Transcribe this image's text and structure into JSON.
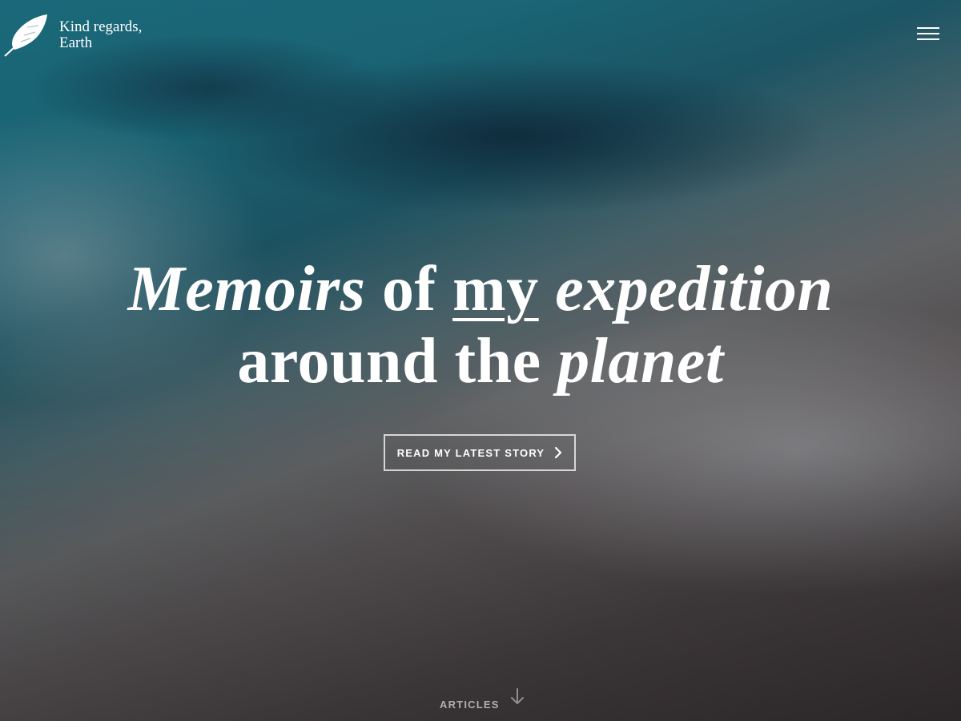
{
  "brand": {
    "line1": "Kind regards,",
    "line2": "Earth",
    "logo_icon": "feather-icon"
  },
  "header": {
    "menu_icon": "hamburger-menu-icon"
  },
  "hero": {
    "headline": {
      "w1": "Memoirs",
      "w2": "of",
      "w3": "my",
      "w4": "expedition",
      "w5": "around the",
      "w6": "planet"
    },
    "cta": {
      "label": "READ MY LATEST STORY",
      "icon": "chevron-right-icon"
    }
  },
  "footer_nav": {
    "articles_label": "ARTICLES",
    "icon": "arrow-down-icon"
  },
  "colors": {
    "text": "#ffffff",
    "ocean": "#1b6e80",
    "sand": "#4a4446"
  }
}
